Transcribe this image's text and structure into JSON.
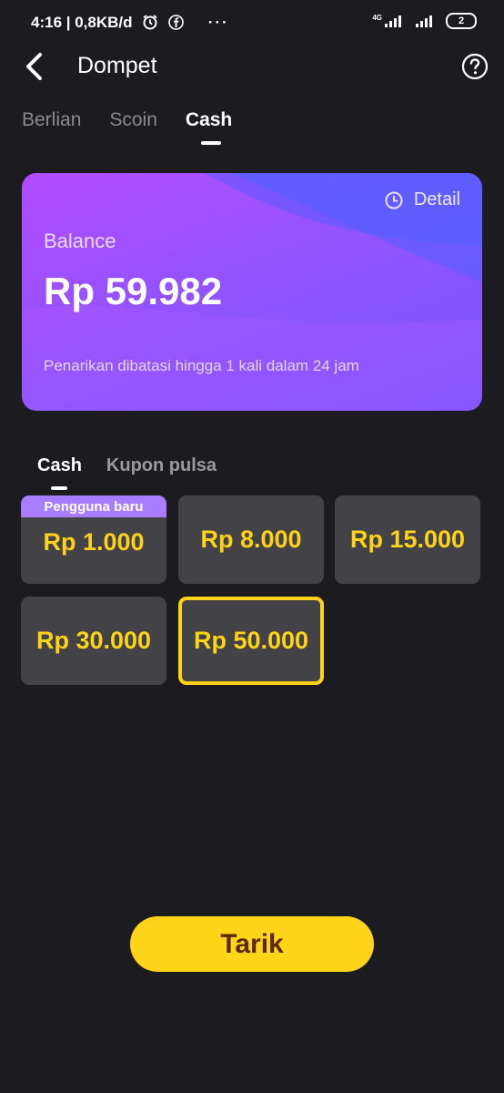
{
  "status_bar": {
    "time_and_speed": "4:16 | 0,8KB/d",
    "more_dots": "···",
    "network": "4G",
    "battery": "2"
  },
  "header": {
    "title": "Dompet",
    "back_icon": "chevron-left-icon",
    "help_icon": "question-circle-icon"
  },
  "tabs": [
    {
      "label": "Berlian",
      "active": false
    },
    {
      "label": "Scoin",
      "active": false
    },
    {
      "label": "Cash",
      "active": true
    }
  ],
  "balance_card": {
    "detail_label": "Detail",
    "label": "Balance",
    "amount": "Rp 59.982",
    "note": "Penarikan dibatasi hingga 1 kali dalam 24 jam"
  },
  "subtabs": [
    {
      "label": "Cash",
      "active": true
    },
    {
      "label": "Kupon pulsa",
      "active": false
    }
  ],
  "amount_options": [
    {
      "amount": "Rp 1.000",
      "badge": "Pengguna baru",
      "selected": false
    },
    {
      "amount": "Rp 8.000",
      "selected": false
    },
    {
      "amount": "Rp 15.000",
      "selected": false
    },
    {
      "amount": "Rp 30.000",
      "selected": false
    },
    {
      "amount": "Rp 50.000",
      "selected": true
    }
  ],
  "withdraw_button": {
    "label": "Tarik"
  },
  "colors": {
    "background": "#1c1b20",
    "accent_yellow": "#ffd21a",
    "card_purple": "#8c54ff",
    "tile": "#434246"
  }
}
